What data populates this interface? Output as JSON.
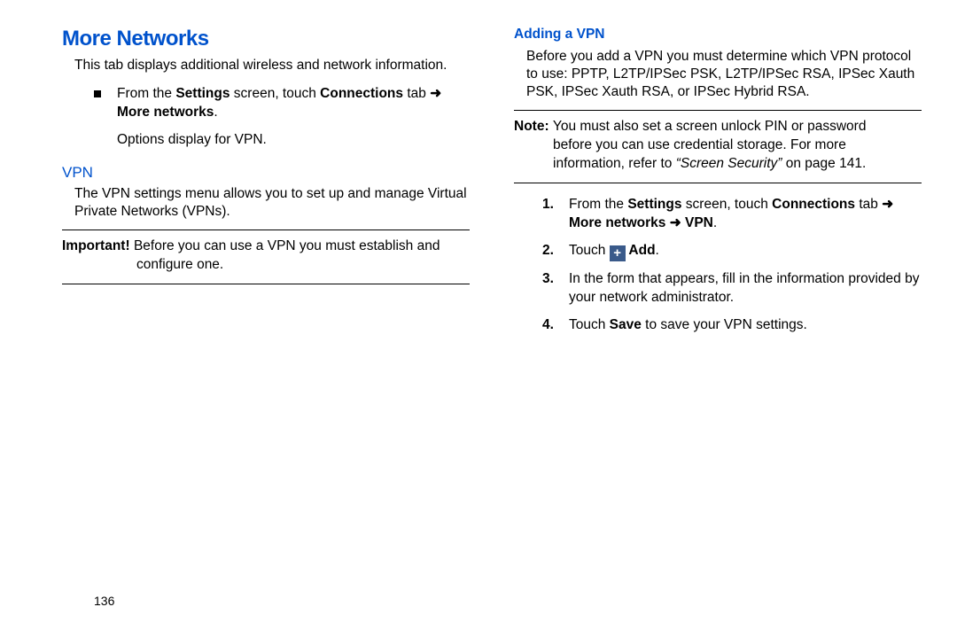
{
  "left": {
    "title": "More Networks",
    "intro": "This tab displays additional wireless and network information.",
    "bullet_prefix": "From the ",
    "bullet_settings": "Settings",
    "bullet_mid": " screen, touch ",
    "bullet_conn": "Connections",
    "bullet_tab": " tab ",
    "bullet_more": "More networks",
    "bullet_sub": "Options display for VPN.",
    "vpn_heading": "VPN",
    "vpn_text": "The VPN settings menu allows you to set up and manage Virtual Private Networks (VPNs).",
    "important_label": "Important! ",
    "important_text1": "Before you can use a VPN you must establish and",
    "important_text2": "configure one."
  },
  "right": {
    "heading": "Adding a VPN",
    "intro": "Before you add a VPN you must determine which VPN protocol to use: PPTP, L2TP/IPSec PSK, L2TP/IPSec RSA, IPSec Xauth PSK, IPSec Xauth RSA, or IPSec Hybrid RSA.",
    "note_label": "Note: ",
    "note_text1": "You must also set a screen unlock PIN or password",
    "note_text2": "before you can use credential storage. For more",
    "note_text3_a": "information, refer to ",
    "note_text3_ref": "“Screen Security”",
    "note_text3_b": " on page 141.",
    "steps": {
      "s1_num": "1.",
      "s1_a": "From the ",
      "s1_settings": "Settings",
      "s1_b": " screen, touch ",
      "s1_conn": "Connections",
      "s1_c": " tab ",
      "s1_more": "More networks ",
      "s1_vpn": " VPN",
      "s2_num": "2.",
      "s2_a": "Touch ",
      "s2_add": " Add",
      "s3_num": "3.",
      "s3_text": "In the form that appears, fill in the information provided by your network administrator.",
      "s4_num": "4.",
      "s4_a": "Touch ",
      "s4_save": "Save",
      "s4_b": " to save your VPN settings."
    }
  },
  "arrow": "➜",
  "page_number": "136"
}
